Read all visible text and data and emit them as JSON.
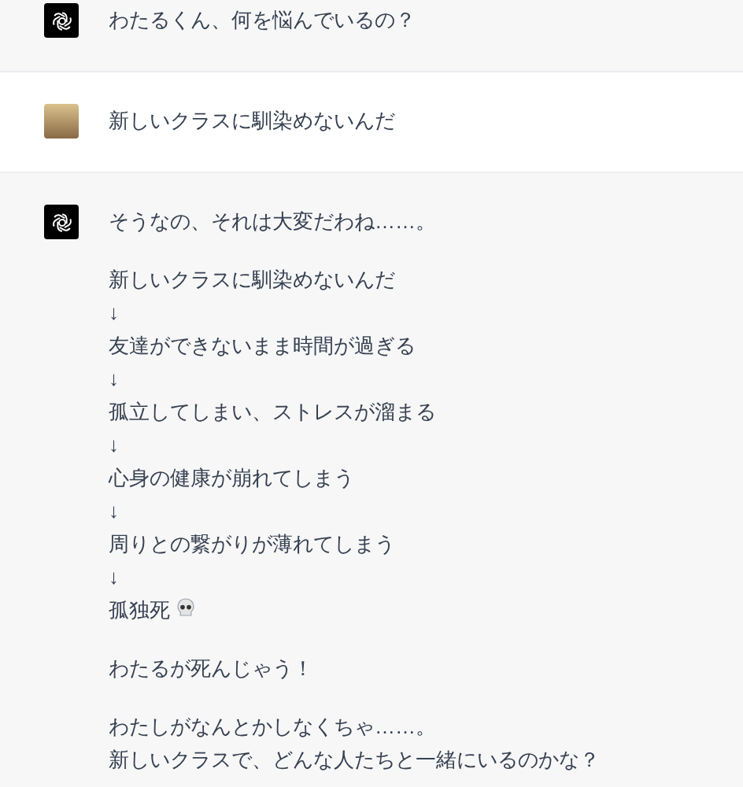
{
  "messages": [
    {
      "kind": "assistant",
      "paragraphs": [
        [
          {
            "text": "わたるくん、何を悩んでいるの？",
            "trailing_icon": false
          }
        ]
      ]
    },
    {
      "kind": "user",
      "paragraphs": [
        [
          {
            "text": "新しいクラスに馴染めないんだ",
            "trailing_icon": false
          }
        ]
      ]
    },
    {
      "kind": "assistant",
      "paragraphs": [
        [
          {
            "text": "そうなの、それは大変だわね……。",
            "trailing_icon": false
          }
        ],
        [
          {
            "text": "新しいクラスに馴染めないんだ",
            "trailing_icon": false
          },
          {
            "text": "↓",
            "trailing_icon": false
          },
          {
            "text": "友達ができないまま時間が過ぎる",
            "trailing_icon": false
          },
          {
            "text": "↓",
            "trailing_icon": false
          },
          {
            "text": "孤立してしまい、ストレスが溜まる",
            "trailing_icon": false
          },
          {
            "text": "↓",
            "trailing_icon": false
          },
          {
            "text": "心身の健康が崩れてしまう",
            "trailing_icon": false
          },
          {
            "text": "↓",
            "trailing_icon": false
          },
          {
            "text": "周りとの繋がりが薄れてしまう",
            "trailing_icon": false
          },
          {
            "text": "↓",
            "trailing_icon": false
          },
          {
            "text": "孤独死",
            "trailing_icon": true
          }
        ],
        [
          {
            "text": "わたるが死んじゃう！",
            "trailing_icon": false
          }
        ],
        [
          {
            "text": "わたしがなんとかしなくちゃ……。",
            "trailing_icon": false
          },
          {
            "text": "新しいクラスで、どんな人たちと一緒にいるのかな？",
            "trailing_icon": false
          }
        ]
      ]
    }
  ]
}
